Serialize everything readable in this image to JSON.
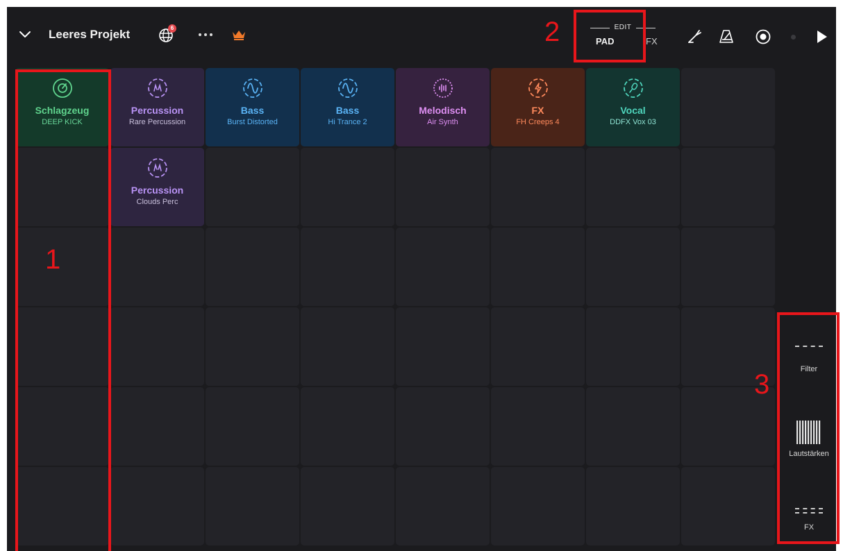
{
  "project": {
    "title": "Leeres Projekt",
    "globe_badge": "6",
    "more_label": "…"
  },
  "edit_switch": {
    "header": "EDIT",
    "pad_label": "PAD",
    "fx_label": "FX"
  },
  "toolbar": {
    "icons": [
      "tuner-icon",
      "metronome-icon",
      "record-icon",
      "play-icon"
    ]
  },
  "colors": {
    "background": "#1b1b1e",
    "empty_pad": "#232328",
    "annotation": "#e8161b"
  },
  "pads": [
    {
      "name": "Schlagzeug",
      "sub": "DEEP KICK",
      "icon": "drum-icon",
      "bg": "#143a2a",
      "fg": "#5fd38d",
      "sub_fg": "#69d699"
    },
    {
      "name": "Percussion",
      "sub": "Rare Percussion",
      "icon": "percussion-icon",
      "bg": "#2e2540",
      "fg": "#b993f5",
      "sub_fg": "#c9c0dc"
    },
    {
      "name": "Bass",
      "sub": "Burst Distorted",
      "icon": "bass-wave-icon",
      "bg": "#12304d",
      "fg": "#5ab3f5",
      "sub_fg": "#5ab3f5"
    },
    {
      "name": "Bass",
      "sub": "Hi Trance 2",
      "icon": "bass-wave-icon",
      "bg": "#12304d",
      "fg": "#5ab3f5",
      "sub_fg": "#5ab3f5"
    },
    {
      "name": "Melodisch",
      "sub": "Air Synth",
      "icon": "synth-icon",
      "bg": "#36223f",
      "fg": "#de8ff2",
      "sub_fg": "#de8ff2"
    },
    {
      "name": "FX",
      "sub": "FH Creeps 4",
      "icon": "fx-bolt-icon",
      "bg": "#4a2418",
      "fg": "#ff8a5c",
      "sub_fg": "#ff8a5c"
    },
    {
      "name": "Vocal",
      "sub": "DDFX Vox 03",
      "icon": "microphone-icon",
      "bg": "#133530",
      "fg": "#4fd6bd",
      "sub_fg": "#8fe3d3"
    },
    {
      "name": "Percussion",
      "sub": "Clouds Perc",
      "icon": "percussion-icon",
      "bg": "#2e2540",
      "fg": "#b993f5",
      "sub_fg": "#c9c0dc"
    }
  ],
  "side_panel": {
    "filter_label": "Filter",
    "volume_label": "Lautstärken",
    "fx_label": "FX"
  },
  "annotations": {
    "label_1": "1",
    "label_2": "2",
    "label_3": "3"
  }
}
